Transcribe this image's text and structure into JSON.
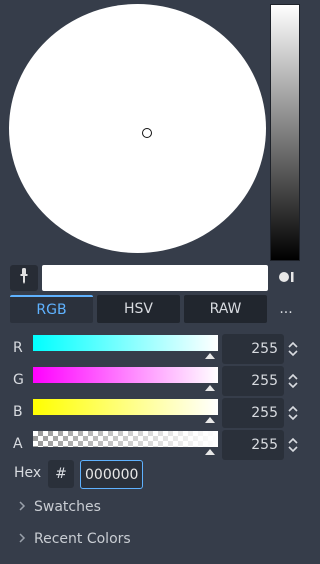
{
  "picker": {
    "color_hex_preview": "#ffffff",
    "accent": "#5fb2ff"
  },
  "tabs": [
    {
      "label": "RGB",
      "active": true
    },
    {
      "label": "HSV",
      "active": false
    },
    {
      "label": "RAW",
      "active": false
    }
  ],
  "more_label": "...",
  "channels": [
    {
      "label": "R",
      "value": "255"
    },
    {
      "label": "G",
      "value": "255"
    },
    {
      "label": "B",
      "value": "255"
    },
    {
      "label": "A",
      "value": "255"
    }
  ],
  "hex": {
    "label": "Hex",
    "hash": "#",
    "value": "000000"
  },
  "sections": [
    {
      "label": "Swatches"
    },
    {
      "label": "Recent Colors"
    }
  ],
  "icons": {
    "eyedropper": "eyedropper-icon",
    "shape_toggle": "picker-shape-icon",
    "spin_arrows": "spin-arrows-icon",
    "chevron": "chevron-right-icon"
  }
}
